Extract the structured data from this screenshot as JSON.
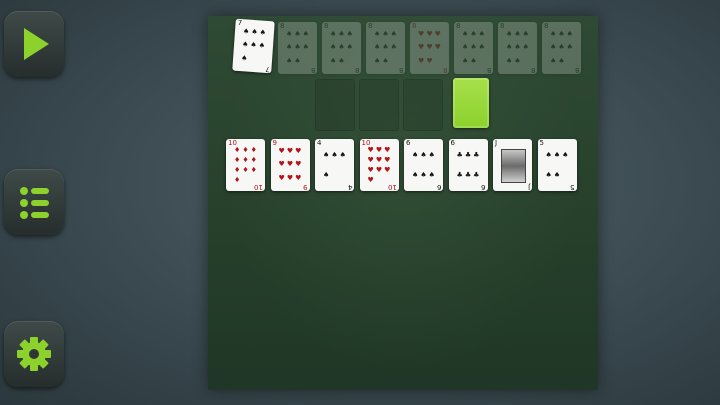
{
  "buttons": {
    "play": {
      "icon": "play-icon"
    },
    "menu": {
      "icon": "list-icon"
    },
    "settings": {
      "icon": "gear-icon"
    }
  },
  "colors": {
    "accent": "#8cd12c",
    "felt": "#2b4530",
    "card_face": "#f7f7f5",
    "red_suit": "#b3141a",
    "black_suit": "#151515"
  },
  "foundations": [
    {
      "rank": "7",
      "suit": "♠",
      "color": "black",
      "faded": false
    },
    {
      "rank": "8",
      "suit": "♠",
      "color": "black",
      "faded": true
    },
    {
      "rank": "8",
      "suit": "♠",
      "color": "black",
      "faded": true
    },
    {
      "rank": "8",
      "suit": "♠",
      "color": "black",
      "faded": true
    },
    {
      "rank": "8",
      "suit": "♥",
      "color": "red",
      "faded": true
    },
    {
      "rank": "8",
      "suit": "♠",
      "color": "black",
      "faded": true
    },
    {
      "rank": "8",
      "suit": "♠",
      "color": "black",
      "faded": true
    },
    {
      "rank": "8",
      "suit": "♠",
      "color": "black",
      "faded": true
    }
  ],
  "reserve_slots": 3,
  "stock_back_color": "#8cd12c",
  "tableau": [
    {
      "rank": "10",
      "suit": "♦",
      "color": "red",
      "pips": 10
    },
    {
      "rank": "9",
      "suit": "♥",
      "color": "red",
      "pips": 9
    },
    {
      "rank": "4",
      "suit": "♠",
      "color": "black",
      "pips": 4
    },
    {
      "rank": "10",
      "suit": "♥",
      "color": "red",
      "pips": 10
    },
    {
      "rank": "6",
      "suit": "♠",
      "color": "black",
      "pips": 6
    },
    {
      "rank": "6",
      "suit": "♣",
      "color": "black",
      "pips": 6
    },
    {
      "rank": "J",
      "suit": "♣",
      "color": "black",
      "pips": 0
    },
    {
      "rank": "5",
      "suit": "♠",
      "color": "black",
      "pips": 5
    }
  ]
}
